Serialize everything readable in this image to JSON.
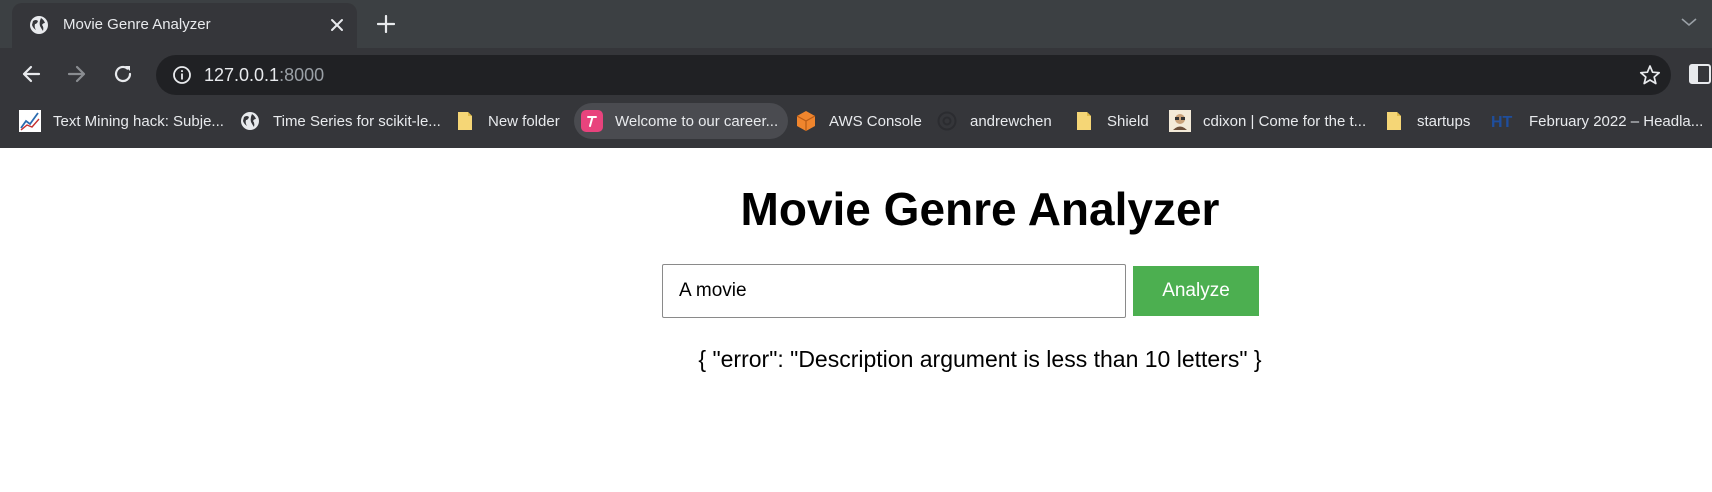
{
  "browser": {
    "tab": {
      "title": "Movie Genre Analyzer",
      "favicon": "globe-icon"
    },
    "url": {
      "host": "127.0.0.1",
      "port": ":8000"
    },
    "bookmarks": [
      {
        "label": "Text Mining hack: Subje...",
        "icon": "chart-favicon-icon"
      },
      {
        "label": "Time Series for scikit-le...",
        "icon": "globe-icon"
      },
      {
        "label": "New folder",
        "icon": "folder-icon"
      },
      {
        "label": "Welcome to our career...",
        "icon": "pink-t-favicon-icon"
      },
      {
        "label": "AWS Console",
        "icon": "aws-cube-icon"
      },
      {
        "label": "andrewchen",
        "icon": "at-sign-icon"
      },
      {
        "label": "Shield",
        "icon": "folder-icon"
      },
      {
        "label": "cdixon | Come for the t...",
        "icon": "avatar-favicon-icon"
      },
      {
        "label": "startups",
        "icon": "folder-icon"
      },
      {
        "label": "February 2022 – Headla...",
        "icon": "ht-favicon-icon"
      }
    ]
  },
  "page": {
    "title": "Movie Genre Analyzer",
    "input_value": "A movie",
    "button_label": "Analyze",
    "result": "{ \"error\": \"Description argument is less than 10 letters\" }"
  },
  "colors": {
    "button": "#4caf50",
    "chrome_dark": "#35363a",
    "tabstrip": "#3c4043"
  }
}
